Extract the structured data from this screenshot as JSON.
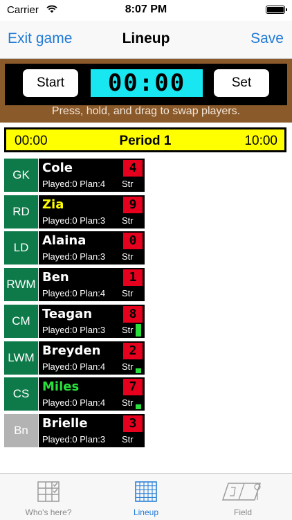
{
  "status_bar": {
    "carrier": "Carrier",
    "time": "8:07 PM"
  },
  "nav": {
    "left": "Exit game",
    "title": "Lineup",
    "right": "Save"
  },
  "timer": {
    "start_label": "Start",
    "clock": "00:00",
    "set_label": "Set",
    "hint": "Press, hold, and drag to swap players."
  },
  "period": {
    "start": "00:00",
    "label": "Period 1",
    "end": "10:00"
  },
  "colors": {
    "accent": "#1f7ad6",
    "panel": "#8b5a2b",
    "clock": "#18e6f0",
    "period_bg": "#ffff00",
    "field_pos": "#0e7a4a",
    "bench_pos": "#b3b3b3",
    "number_bg": "#e6001e",
    "strength": "#27e03a"
  },
  "players": [
    {
      "pos": "GK",
      "name": "Cole",
      "played": "Played:0 Plan:4",
      "str": "Str",
      "number": "4",
      "name_color": "#ffffff",
      "pos_color": "#0e7a4a",
      "strength_level": 0
    },
    {
      "pos": "RD",
      "name": "Zia",
      "played": "Played:0 Plan:3",
      "str": "Str",
      "number": "9",
      "name_color": "#ffff00",
      "pos_color": "#0e7a4a",
      "strength_level": 0
    },
    {
      "pos": "LD",
      "name": "Alaina",
      "played": "Played:0 Plan:3",
      "str": "Str",
      "number": "0",
      "name_color": "#ffffff",
      "pos_color": "#0e7a4a",
      "strength_level": 0
    },
    {
      "pos": "RWM",
      "name": "Ben",
      "played": "Played:0 Plan:4",
      "str": "Str",
      "number": "1",
      "name_color": "#ffffff",
      "pos_color": "#0e7a4a",
      "strength_level": 0
    },
    {
      "pos": "CM",
      "name": "Teagan",
      "played": "Played:0 Plan:3",
      "str": "Str",
      "number": "8",
      "name_color": "#ffffff",
      "pos_color": "#0e7a4a",
      "strength_level": 1
    },
    {
      "pos": "LWM",
      "name": "Breyden",
      "played": "Played:0 Plan:4",
      "str": "Str",
      "number": "2",
      "name_color": "#ffffff",
      "pos_color": "#0e7a4a",
      "strength_level": 0.4
    },
    {
      "pos": "CS",
      "name": "Miles",
      "played": "Played:0 Plan:4",
      "str": "Str",
      "number": "7",
      "name_color": "#27e03a",
      "pos_color": "#0e7a4a",
      "strength_level": 0.4
    },
    {
      "pos": "Bn",
      "name": "Brielle",
      "played": "Played:0 Plan:3",
      "str": "Str",
      "number": "3",
      "name_color": "#ffffff",
      "pos_color": "#b3b3b3",
      "strength_level": 0
    }
  ],
  "tabs": [
    {
      "label": "Who's here?",
      "icon": "checklist-icon",
      "active": false
    },
    {
      "label": "Lineup",
      "icon": "grid-icon",
      "active": true
    },
    {
      "label": "Field",
      "icon": "field-icon",
      "active": false
    }
  ]
}
